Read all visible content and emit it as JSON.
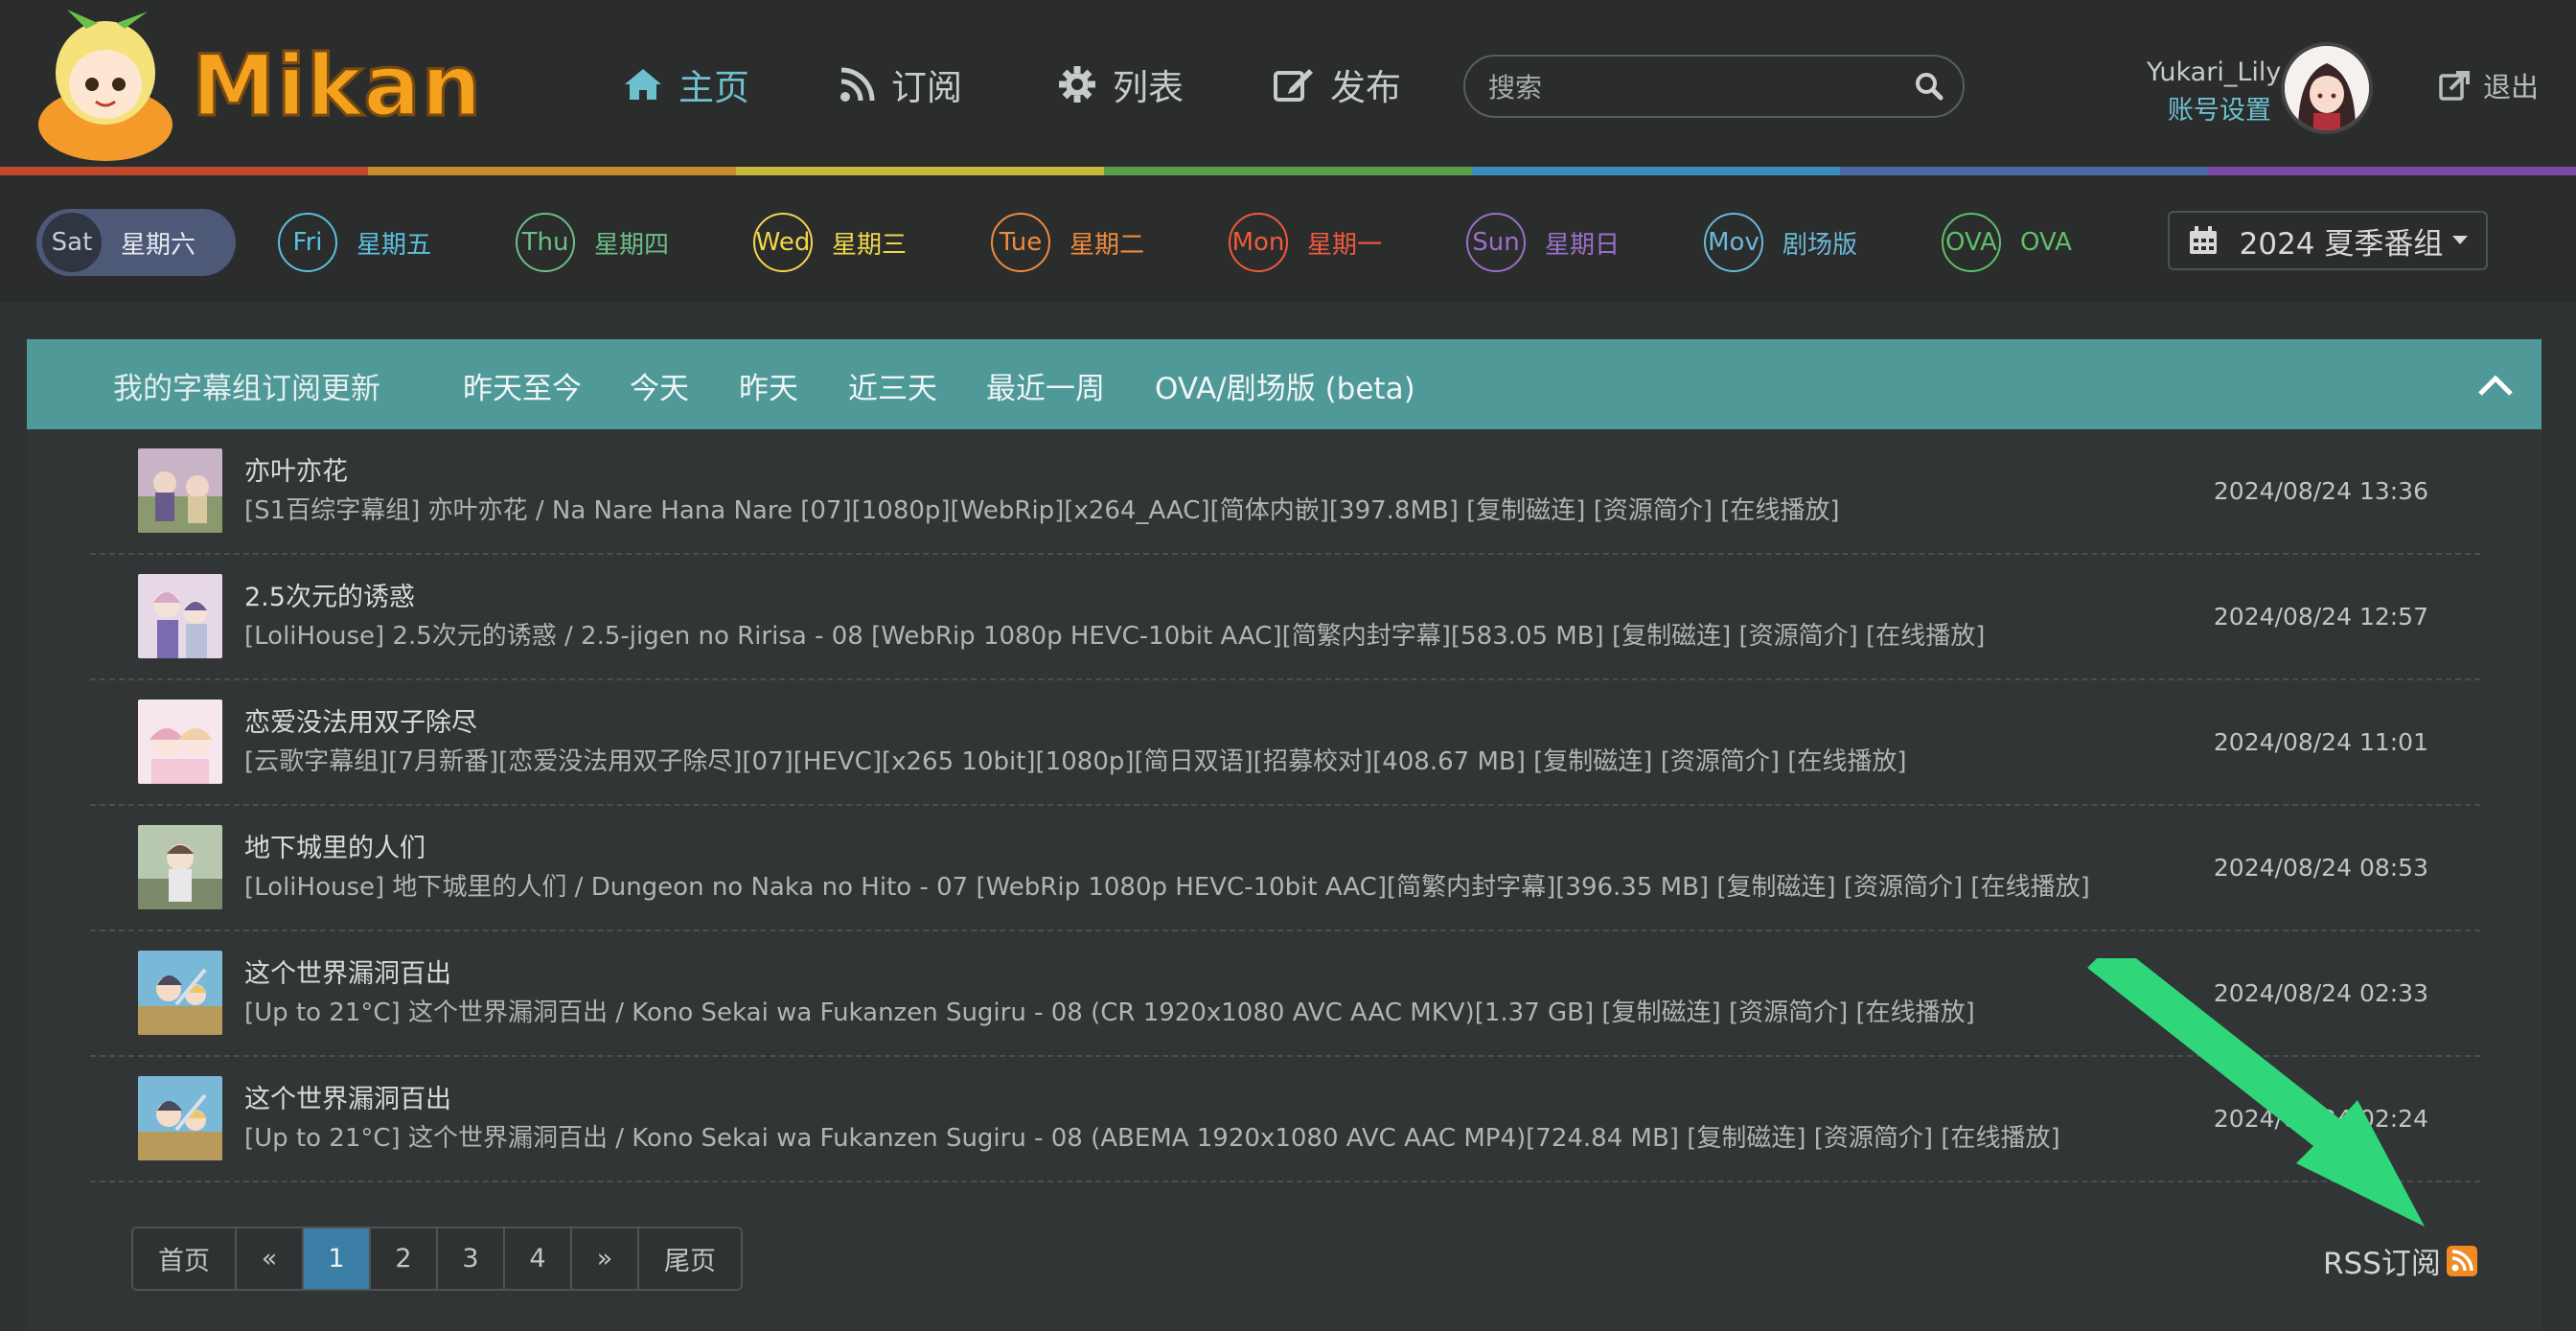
{
  "brand": {
    "name": "Mikan"
  },
  "nav": [
    {
      "label": "主页",
      "icon": "home-icon"
    },
    {
      "label": "订阅",
      "icon": "rss-feed-icon"
    },
    {
      "label": "列表",
      "icon": "puzzle-icon"
    },
    {
      "label": "发布",
      "icon": "edit-icon"
    }
  ],
  "search": {
    "placeholder": "搜索",
    "value": ""
  },
  "user": {
    "name": "Yukari_Lily",
    "account_label": "账号设置",
    "logout_label": "退出"
  },
  "days": [
    {
      "abbr": "Sat",
      "label": "星期六",
      "color": "#4d5977"
    },
    {
      "abbr": "Fri",
      "label": "星期五",
      "color": "#5bc0de"
    },
    {
      "abbr": "Thu",
      "label": "星期四",
      "color": "#6bbf86"
    },
    {
      "abbr": "Wed",
      "label": "星期三",
      "color": "#f2d64a"
    },
    {
      "abbr": "Tue",
      "label": "星期二",
      "color": "#f08a3c"
    },
    {
      "abbr": "Mon",
      "label": "星期一",
      "color": "#ee5a3c"
    },
    {
      "abbr": "Sun",
      "label": "星期日",
      "color": "#9b6fc8"
    },
    {
      "abbr": "Mov",
      "label": "剧场版",
      "color": "#6cb8d8"
    },
    {
      "abbr": "OVA",
      "label": "OVA",
      "color": "#5fbf6a"
    }
  ],
  "season": {
    "label": "2024 夏季番组"
  },
  "panel": {
    "title": "我的字幕组订阅更新",
    "tabs": [
      "昨天至今",
      "今天",
      "昨天",
      "近三天",
      "最近一周",
      "OVA/剧场版 (beta)"
    ]
  },
  "updates": [
    {
      "title": "亦叶亦花",
      "desc": "[S1百综字幕组] 亦叶亦花 / Na Nare Hana Nare [07][1080p][WebRip][x264_AAC][简体内嵌][397.8MB] [复制磁连] [资源简介] [在线播放]",
      "date": "2024/08/24 13:36"
    },
    {
      "title": "2.5次元的诱惑",
      "desc": "[LoliHouse] 2.5次元的诱惑 / 2.5-jigen no Ririsa - 08 [WebRip 1080p HEVC-10bit AAC][简繁内封字幕][583.05 MB] [复制磁连] [资源简介] [在线播放]",
      "date": "2024/08/24 12:57"
    },
    {
      "title": "恋爱没法用双子除尽",
      "desc": "[云歌字幕组][7月新番][恋爱没法用双子除尽][07][HEVC][x265 10bit][1080p][简日双语][招募校对][408.67 MB] [复制磁连] [资源简介] [在线播放]",
      "date": "2024/08/24 11:01"
    },
    {
      "title": "地下城里的人们",
      "desc": "[LoliHouse] 地下城里的人们 / Dungeon no Naka no Hito - 07 [WebRip 1080p HEVC-10bit AAC][简繁内封字幕][396.35 MB] [复制磁连] [资源简介] [在线播放]",
      "date": "2024/08/24 08:53"
    },
    {
      "title": "这个世界漏洞百出",
      "desc": "[Up to 21°C] 这个世界漏洞百出 / Kono Sekai wa Fukanzen Sugiru - 08 (CR 1920x1080 AVC AAC MKV)[1.37 GB] [复制磁连] [资源简介] [在线播放]",
      "date": "2024/08/24 02:33"
    },
    {
      "title": "这个世界漏洞百出",
      "desc": "[Up to 21°C] 这个世界漏洞百出 / Kono Sekai wa Fukanzen Sugiru - 08 (ABEMA 1920x1080 AVC AAC MP4)[724.84 MB] [复制磁连] [资源简介] [在线播放]",
      "date": "2024/08/24 02:24"
    }
  ],
  "pagination": {
    "first": "首页",
    "prev": "«",
    "pages": [
      "1",
      "2",
      "3",
      "4"
    ],
    "current": "1",
    "next": "»",
    "last": "尾页"
  },
  "rss": {
    "label": "RSS订阅"
  },
  "colors": {
    "accent": "#4f9999",
    "link": "#6fc0cf",
    "annotation_arrow": "#2fd67a"
  }
}
